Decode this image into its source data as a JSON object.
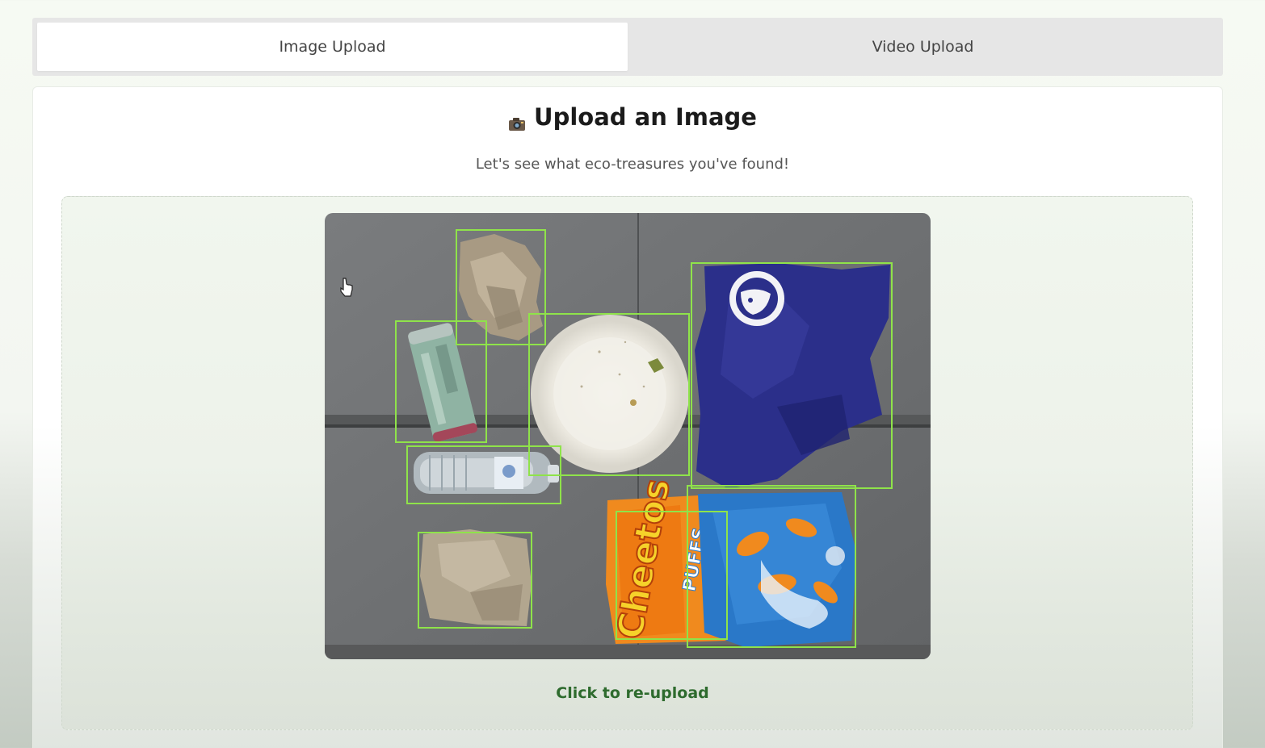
{
  "tabs": [
    {
      "label": "Image Upload",
      "active": true
    },
    {
      "label": "Video Upload",
      "active": false
    }
  ],
  "upload": {
    "icon": "camera-icon",
    "title": "Upload an Image",
    "subtitle": "Let's see what eco-treasures you've found!",
    "reupload_label": "Click to re-upload"
  },
  "detections": {
    "box_color": "#8fe34a",
    "items": [
      "crumpled-paper",
      "aluminum-can",
      "paper-plate",
      "t-shirt",
      "plastic-bottle",
      "paper-bag",
      "cheetos-bag",
      "snack-bag"
    ]
  },
  "colors": {
    "accent": "#2e6b2e",
    "tab_bg": "#e6e6e6"
  }
}
